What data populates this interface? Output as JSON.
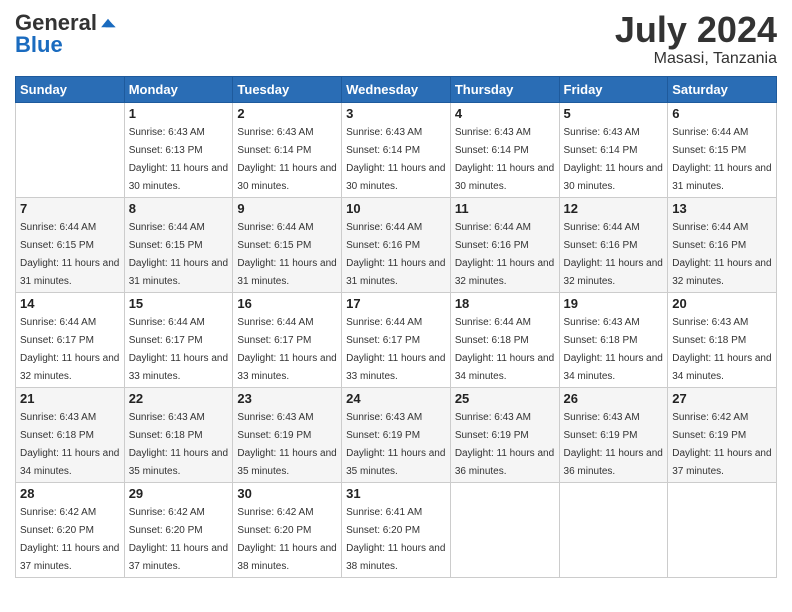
{
  "logo": {
    "general": "General",
    "blue": "Blue"
  },
  "title": "July 2024",
  "location": "Masasi, Tanzania",
  "headers": [
    "Sunday",
    "Monday",
    "Tuesday",
    "Wednesday",
    "Thursday",
    "Friday",
    "Saturday"
  ],
  "weeks": [
    [
      {
        "num": "",
        "sunrise": "",
        "sunset": "",
        "daylight": ""
      },
      {
        "num": "1",
        "sunrise": "Sunrise: 6:43 AM",
        "sunset": "Sunset: 6:13 PM",
        "daylight": "Daylight: 11 hours and 30 minutes."
      },
      {
        "num": "2",
        "sunrise": "Sunrise: 6:43 AM",
        "sunset": "Sunset: 6:14 PM",
        "daylight": "Daylight: 11 hours and 30 minutes."
      },
      {
        "num": "3",
        "sunrise": "Sunrise: 6:43 AM",
        "sunset": "Sunset: 6:14 PM",
        "daylight": "Daylight: 11 hours and 30 minutes."
      },
      {
        "num": "4",
        "sunrise": "Sunrise: 6:43 AM",
        "sunset": "Sunset: 6:14 PM",
        "daylight": "Daylight: 11 hours and 30 minutes."
      },
      {
        "num": "5",
        "sunrise": "Sunrise: 6:43 AM",
        "sunset": "Sunset: 6:14 PM",
        "daylight": "Daylight: 11 hours and 30 minutes."
      },
      {
        "num": "6",
        "sunrise": "Sunrise: 6:44 AM",
        "sunset": "Sunset: 6:15 PM",
        "daylight": "Daylight: 11 hours and 31 minutes."
      }
    ],
    [
      {
        "num": "7",
        "sunrise": "Sunrise: 6:44 AM",
        "sunset": "Sunset: 6:15 PM",
        "daylight": "Daylight: 11 hours and 31 minutes."
      },
      {
        "num": "8",
        "sunrise": "Sunrise: 6:44 AM",
        "sunset": "Sunset: 6:15 PM",
        "daylight": "Daylight: 11 hours and 31 minutes."
      },
      {
        "num": "9",
        "sunrise": "Sunrise: 6:44 AM",
        "sunset": "Sunset: 6:15 PM",
        "daylight": "Daylight: 11 hours and 31 minutes."
      },
      {
        "num": "10",
        "sunrise": "Sunrise: 6:44 AM",
        "sunset": "Sunset: 6:16 PM",
        "daylight": "Daylight: 11 hours and 31 minutes."
      },
      {
        "num": "11",
        "sunrise": "Sunrise: 6:44 AM",
        "sunset": "Sunset: 6:16 PM",
        "daylight": "Daylight: 11 hours and 32 minutes."
      },
      {
        "num": "12",
        "sunrise": "Sunrise: 6:44 AM",
        "sunset": "Sunset: 6:16 PM",
        "daylight": "Daylight: 11 hours and 32 minutes."
      },
      {
        "num": "13",
        "sunrise": "Sunrise: 6:44 AM",
        "sunset": "Sunset: 6:16 PM",
        "daylight": "Daylight: 11 hours and 32 minutes."
      }
    ],
    [
      {
        "num": "14",
        "sunrise": "Sunrise: 6:44 AM",
        "sunset": "Sunset: 6:17 PM",
        "daylight": "Daylight: 11 hours and 32 minutes."
      },
      {
        "num": "15",
        "sunrise": "Sunrise: 6:44 AM",
        "sunset": "Sunset: 6:17 PM",
        "daylight": "Daylight: 11 hours and 33 minutes."
      },
      {
        "num": "16",
        "sunrise": "Sunrise: 6:44 AM",
        "sunset": "Sunset: 6:17 PM",
        "daylight": "Daylight: 11 hours and 33 minutes."
      },
      {
        "num": "17",
        "sunrise": "Sunrise: 6:44 AM",
        "sunset": "Sunset: 6:17 PM",
        "daylight": "Daylight: 11 hours and 33 minutes."
      },
      {
        "num": "18",
        "sunrise": "Sunrise: 6:44 AM",
        "sunset": "Sunset: 6:18 PM",
        "daylight": "Daylight: 11 hours and 34 minutes."
      },
      {
        "num": "19",
        "sunrise": "Sunrise: 6:43 AM",
        "sunset": "Sunset: 6:18 PM",
        "daylight": "Daylight: 11 hours and 34 minutes."
      },
      {
        "num": "20",
        "sunrise": "Sunrise: 6:43 AM",
        "sunset": "Sunset: 6:18 PM",
        "daylight": "Daylight: 11 hours and 34 minutes."
      }
    ],
    [
      {
        "num": "21",
        "sunrise": "Sunrise: 6:43 AM",
        "sunset": "Sunset: 6:18 PM",
        "daylight": "Daylight: 11 hours and 34 minutes."
      },
      {
        "num": "22",
        "sunrise": "Sunrise: 6:43 AM",
        "sunset": "Sunset: 6:18 PM",
        "daylight": "Daylight: 11 hours and 35 minutes."
      },
      {
        "num": "23",
        "sunrise": "Sunrise: 6:43 AM",
        "sunset": "Sunset: 6:19 PM",
        "daylight": "Daylight: 11 hours and 35 minutes."
      },
      {
        "num": "24",
        "sunrise": "Sunrise: 6:43 AM",
        "sunset": "Sunset: 6:19 PM",
        "daylight": "Daylight: 11 hours and 35 minutes."
      },
      {
        "num": "25",
        "sunrise": "Sunrise: 6:43 AM",
        "sunset": "Sunset: 6:19 PM",
        "daylight": "Daylight: 11 hours and 36 minutes."
      },
      {
        "num": "26",
        "sunrise": "Sunrise: 6:43 AM",
        "sunset": "Sunset: 6:19 PM",
        "daylight": "Daylight: 11 hours and 36 minutes."
      },
      {
        "num": "27",
        "sunrise": "Sunrise: 6:42 AM",
        "sunset": "Sunset: 6:19 PM",
        "daylight": "Daylight: 11 hours and 37 minutes."
      }
    ],
    [
      {
        "num": "28",
        "sunrise": "Sunrise: 6:42 AM",
        "sunset": "Sunset: 6:20 PM",
        "daylight": "Daylight: 11 hours and 37 minutes."
      },
      {
        "num": "29",
        "sunrise": "Sunrise: 6:42 AM",
        "sunset": "Sunset: 6:20 PM",
        "daylight": "Daylight: 11 hours and 37 minutes."
      },
      {
        "num": "30",
        "sunrise": "Sunrise: 6:42 AM",
        "sunset": "Sunset: 6:20 PM",
        "daylight": "Daylight: 11 hours and 38 minutes."
      },
      {
        "num": "31",
        "sunrise": "Sunrise: 6:41 AM",
        "sunset": "Sunset: 6:20 PM",
        "daylight": "Daylight: 11 hours and 38 minutes."
      },
      {
        "num": "",
        "sunrise": "",
        "sunset": "",
        "daylight": ""
      },
      {
        "num": "",
        "sunrise": "",
        "sunset": "",
        "daylight": ""
      },
      {
        "num": "",
        "sunrise": "",
        "sunset": "",
        "daylight": ""
      }
    ]
  ]
}
